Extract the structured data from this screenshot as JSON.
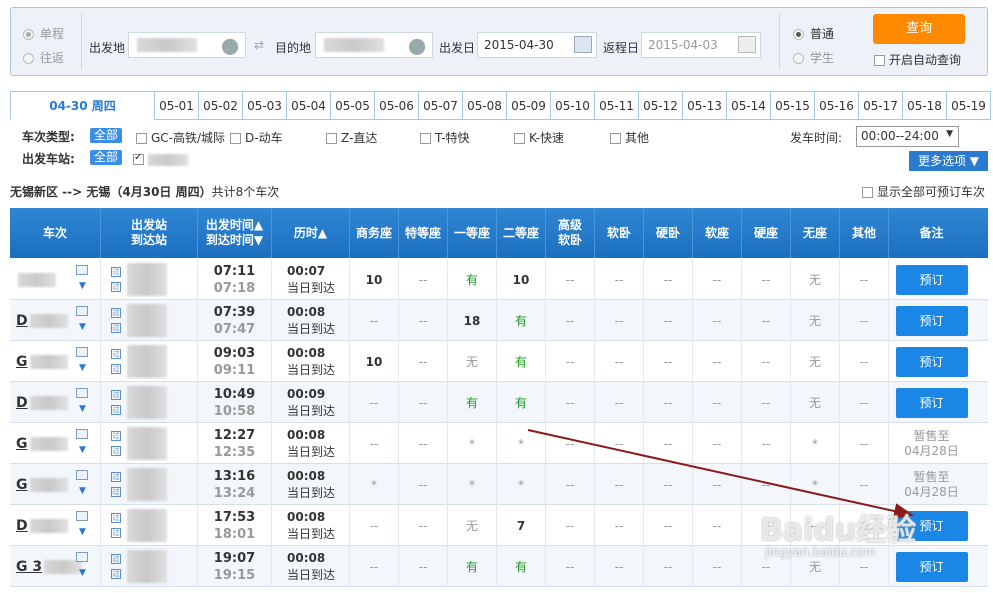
{
  "query": {
    "trip_single": "单程",
    "trip_round": "往返",
    "from_label": "出发地",
    "to_label": "目的地",
    "depart_label": "出发日",
    "depart_value": "2015-04-30",
    "return_label": "返程日",
    "return_value": "2015-04-03",
    "type_normal": "普通",
    "type_student": "学生",
    "search_btn": "查询",
    "auto_query": "开启自动查询"
  },
  "date_tabs": [
    "04-30 周四",
    "05-01",
    "05-02",
    "05-03",
    "05-04",
    "05-05",
    "05-06",
    "05-07",
    "05-08",
    "05-09",
    "05-10",
    "05-11",
    "05-12",
    "05-13",
    "05-14",
    "05-15",
    "05-16",
    "05-17",
    "05-18",
    "05-19"
  ],
  "filters": {
    "type_label": "车次类型:",
    "all": "全部",
    "types": [
      "GC-高铁/城际",
      "D-动车",
      "Z-直达",
      "T-特快",
      "K-快速",
      "其他"
    ],
    "time_label": "发车时间:",
    "time_value": "00:00--24:00",
    "station_label": "出发车站:",
    "more": "更多选项"
  },
  "summary": {
    "route": "无锡新区 --> 无锡（4月30日 周四）",
    "count": "共计8个车次",
    "show_all": "显示全部可预订车次"
  },
  "columns": [
    "车次",
    "出发站\n到达站",
    "出发时间▲\n到达时间▼",
    "历时▲",
    "商务座",
    "特等座",
    "一等座",
    "二等座",
    "高级\n软卧",
    "软卧",
    "硬卧",
    "软座",
    "硬座",
    "无座",
    "其他",
    "备注"
  ],
  "rows": [
    {
      "code": "",
      "dep": "07:11",
      "arr": "07:18",
      "dur": "00:07",
      "day": "当日到达",
      "seats": [
        "10",
        "--",
        "有",
        "10",
        "--",
        "--",
        "--",
        "--",
        "--",
        "无",
        "--"
      ],
      "note": "预订"
    },
    {
      "code": "D",
      "dep": "07:39",
      "arr": "07:47",
      "dur": "00:08",
      "day": "当日到达",
      "seats": [
        "--",
        "--",
        "18",
        "有",
        "--",
        "--",
        "--",
        "--",
        "--",
        "无",
        "--"
      ],
      "note": "预订"
    },
    {
      "code": "G",
      "dep": "09:03",
      "arr": "09:11",
      "dur": "00:08",
      "day": "当日到达",
      "seats": [
        "10",
        "--",
        "无",
        "有",
        "--",
        "--",
        "--",
        "--",
        "--",
        "无",
        "--"
      ],
      "note": "预订"
    },
    {
      "code": "D",
      "dep": "10:49",
      "arr": "10:58",
      "dur": "00:09",
      "day": "当日到达",
      "seats": [
        "--",
        "--",
        "有",
        "有",
        "--",
        "--",
        "--",
        "--",
        "--",
        "无",
        "--"
      ],
      "note": "预订"
    },
    {
      "code": "G",
      "dep": "12:27",
      "arr": "12:35",
      "dur": "00:08",
      "day": "当日到达",
      "seats": [
        "--",
        "--",
        "*",
        "*",
        "--",
        "--",
        "--",
        "--",
        "--",
        "*",
        "--"
      ],
      "note": "暂售至\n04月28日"
    },
    {
      "code": "G",
      "dep": "13:16",
      "arr": "13:24",
      "dur": "00:08",
      "day": "当日到达",
      "seats": [
        "*",
        "--",
        "*",
        "*",
        "--",
        "--",
        "--",
        "--",
        "--",
        "*",
        "--"
      ],
      "note": "暂售至\n04月28日"
    },
    {
      "code": "D",
      "dep": "17:53",
      "arr": "18:01",
      "dur": "00:08",
      "day": "当日到达",
      "seats": [
        "--",
        "--",
        "无",
        "7",
        "--",
        "--",
        "--",
        "--",
        "--",
        "--",
        "--"
      ],
      "note": "预订"
    },
    {
      "code": "G 3",
      "dep": "19:07",
      "arr": "19:15",
      "dur": "00:08",
      "day": "当日到达",
      "seats": [
        "--",
        "--",
        "有",
        "有",
        "--",
        "--",
        "--",
        "--",
        "--",
        "无",
        "--"
      ],
      "note": "预订"
    }
  ],
  "watermark": "Baidu经验",
  "watermark_url": "jingyan.baidu.com"
}
